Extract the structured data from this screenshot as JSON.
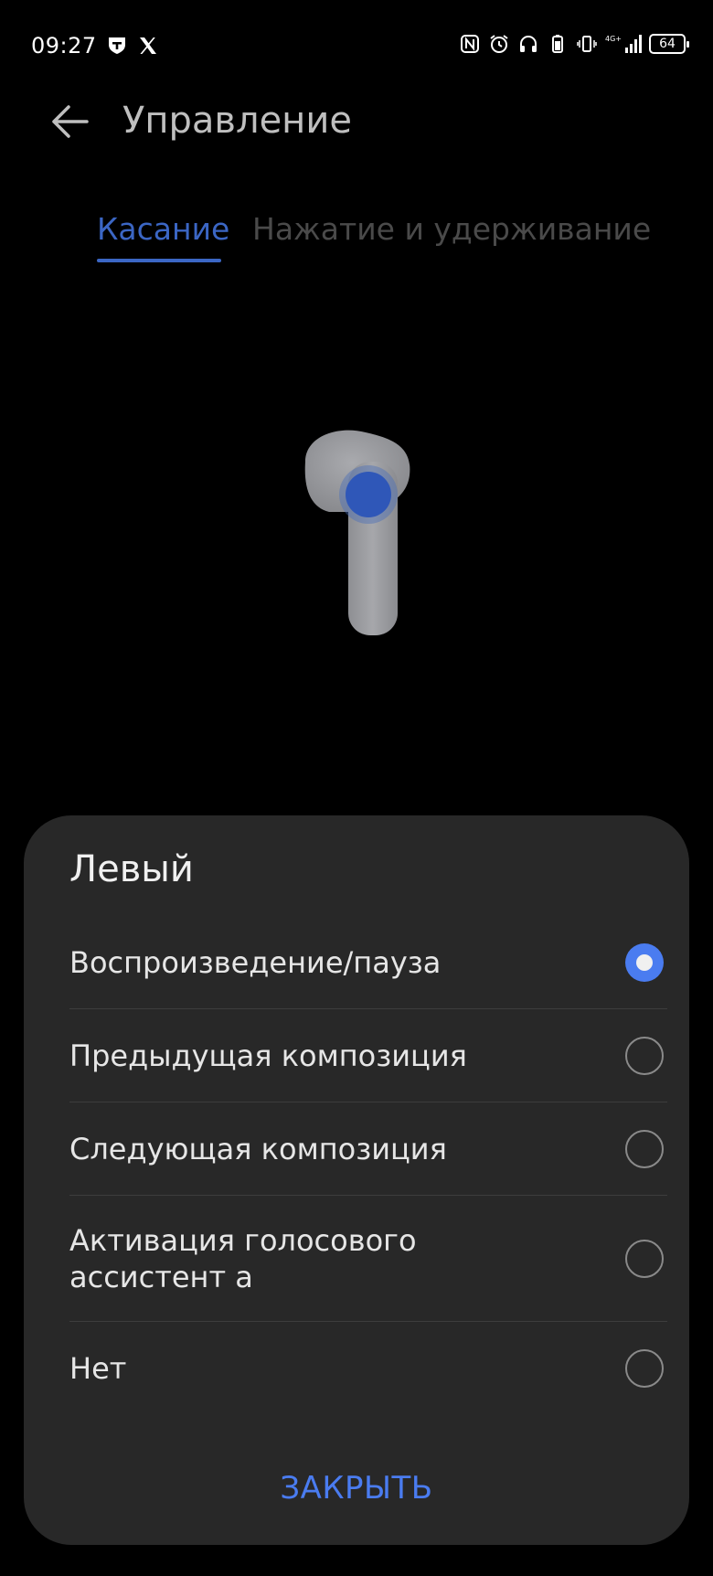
{
  "status_bar": {
    "time": "09:27",
    "battery": "64",
    "left_icons": [
      "tinkoff-icon",
      "x-twitter-icon"
    ],
    "right_icons": [
      "nfc-icon",
      "alarm-icon",
      "headphones-icon",
      "battery-case-icon",
      "vibrate-icon",
      "signal-4g-icon"
    ]
  },
  "header": {
    "title": "Управление"
  },
  "tabs": [
    {
      "label": "Касание",
      "active": true
    },
    {
      "label": "Нажатие и удерживание",
      "active": false
    }
  ],
  "sheet": {
    "title": "Левый",
    "options": [
      {
        "label": "Воспроизведение/пауза",
        "selected": true
      },
      {
        "label": "Предыдущая композиция",
        "selected": false
      },
      {
        "label": "Следующая композиция",
        "selected": false
      },
      {
        "label": "Активация голосового ассистент а",
        "selected": false
      },
      {
        "label": "Нет",
        "selected": false
      }
    ],
    "close_label": "ЗАКРЫТЬ"
  },
  "colors": {
    "accent": "#4a7cf0",
    "tab_active": "#3b66c4",
    "sheet_bg": "#282828",
    "background": "#000000"
  }
}
